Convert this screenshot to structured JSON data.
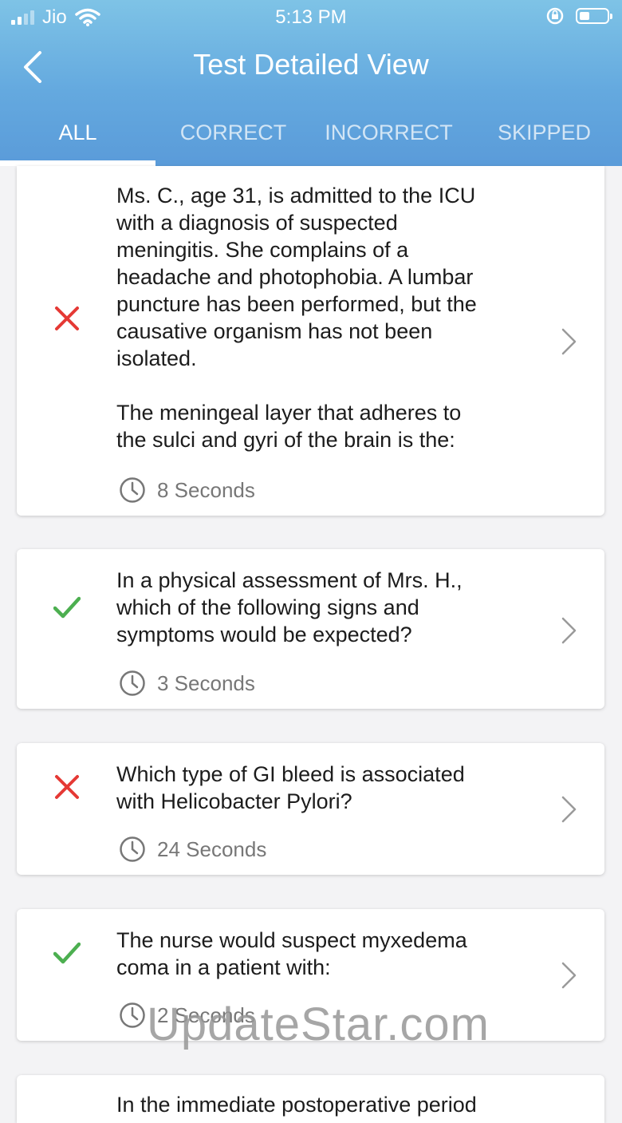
{
  "status_bar": {
    "carrier": "Jio",
    "time": "5:13 PM"
  },
  "header": {
    "title": "Test Detailed View"
  },
  "tabs": [
    {
      "label": "ALL",
      "active": true
    },
    {
      "label": "CORRECT",
      "active": false
    },
    {
      "label": "INCORRECT",
      "active": false
    },
    {
      "label": "SKIPPED",
      "active": false
    }
  ],
  "colors": {
    "incorrect": "#e53935",
    "correct": "#4caf50",
    "header_top": "#7ec3e6",
    "header_bottom": "#5a9bd9"
  },
  "questions": [
    {
      "status": "incorrect",
      "status_icon": "cross-icon",
      "text": "Ms. C., age 31, is admitted to the ICU\nwith a diagnosis of suspected\nmeningitis. She complains of a\nheadache and photophobia. A lumbar\npuncture has been performed, but the\ncausative organism has not been\nisolated.\n\nThe meningeal layer that adheres to\nthe sulci and gyri of the brain is the:",
      "time": "8 Seconds"
    },
    {
      "status": "correct",
      "status_icon": "check-icon",
      "text": "In a physical assessment of Mrs. H.,\nwhich of the following signs and\nsymptoms would be expected?",
      "time": "3 Seconds"
    },
    {
      "status": "incorrect",
      "status_icon": "cross-icon",
      "text": "Which type of GI bleed is associated\nwith Helicobacter Pylori?",
      "time": "24 Seconds"
    },
    {
      "status": "correct",
      "status_icon": "check-icon",
      "text": "The nurse would suspect myxedema\ncoma in a patient with:",
      "time": "2 Seconds"
    },
    {
      "status": "",
      "status_icon": "",
      "text": "In the immediate postoperative period",
      "time": ""
    }
  ],
  "watermark": "UpdateStar.com"
}
